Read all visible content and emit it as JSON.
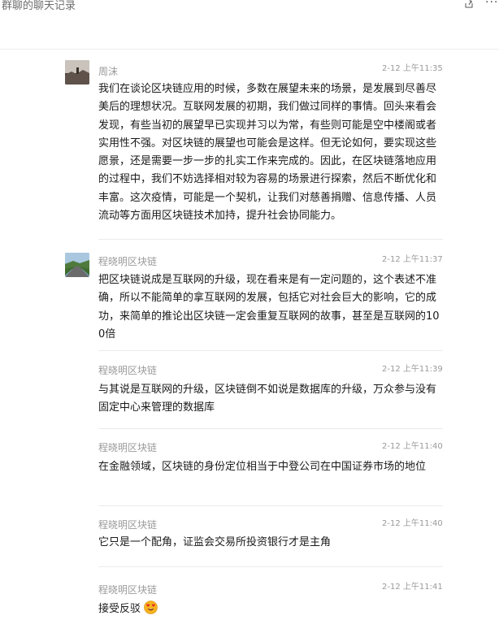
{
  "window": {
    "title": "群聊的聊天记录",
    "share_icon": "share-icon",
    "more_icon": "more-icon"
  },
  "messages": [
    {
      "sender": "周沫",
      "time": "2-12 上午11:35",
      "avatar": "avatar-dusk-landscape",
      "text": "我们在谈论区块链应用的时候，多数在展望未来的场景，是发展到尽善尽美后的理想状况。互联网发展的初期，我们做过同样的事情。回头来看会发现，有些当初的展望早已实现并习以为常，有些则可能是空中楼阁或者实用性不强。对区块链的展望也可能会是这样。但无论如何，要实现这些愿景，还是需要一步一步的扎实工作来完成的。因此，在区块链落地应用的过程中，我们不妨选择相对较为容易的场景进行探索，然后不断优化和丰富。这次疫情，可能是一个契机，让我们对慈善捐赠、信息传播、人员流动等方面用区块链技术加持，提升社会协同能力。"
    },
    {
      "sender": "程晓明区块链",
      "time": "2-12 上午11:37",
      "avatar": "avatar-mountain-road",
      "text": "把区块链说成是互联网的升级，现在看来是有一定问题的，这个表述不准确，所以不能简单的拿互联网的发展，包括它对社会巨大的影响，它的成功，来简单的推论出区块链一定会重复互联网的故事，甚至是互联网的100倍"
    },
    {
      "sender": "程晓明区块链",
      "time": "2-12 上午11:39",
      "text": "与其说是互联网的升级，区块链倒不如说是数据库的升级，万众参与没有固定中心来管理的数据库"
    },
    {
      "sender": "程晓明区块链",
      "time": "2-12 上午11:40",
      "text": "在金融领域，区块链的身份定位相当于中登公司在中国证券市场的地位"
    },
    {
      "sender": "程晓明区块链",
      "time": "2-12 上午11:40",
      "text": "它只是一个配角，证监会交易所投资银行才是主角"
    },
    {
      "sender": "程晓明区块链",
      "time": "2-12 上午11:41",
      "text": "接受反驳",
      "emoji": "heart-eyes-emoji"
    }
  ]
}
